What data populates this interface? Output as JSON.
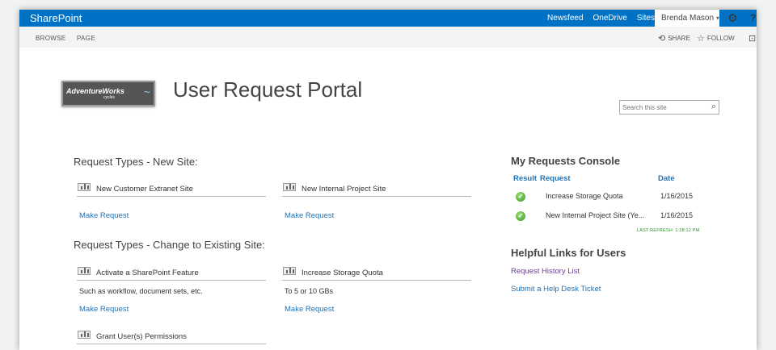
{
  "suite_bar": {
    "brand": "SharePoint",
    "nav": [
      "Newsfeed",
      "OneDrive",
      "Sites"
    ],
    "user": "Brenda Mason",
    "colors": {
      "bar": "#0072c6",
      "link": "#1e72b8",
      "visited": "#6f3b95",
      "ok": "#3a9a1e"
    }
  },
  "ribbon": {
    "tabs": [
      "BROWSE",
      "PAGE"
    ],
    "share": "SHARE",
    "follow": "FOLLOW"
  },
  "logo": {
    "main": "AdventureWorks",
    "sub": "cycles"
  },
  "site_title": "User Request Portal",
  "search": {
    "placeholder": "Search this site"
  },
  "new_site": {
    "title": "Request Types - New Site:",
    "items": [
      {
        "label": "New Customer Extranet Site",
        "action": "Make Request"
      },
      {
        "label": "New Internal Project Site",
        "action": "Make Request"
      }
    ]
  },
  "existing_site": {
    "title": "Request Types - Change to Existing Site:",
    "items": [
      {
        "label": "Activate a SharePoint Feature",
        "desc": "Such as workflow, document sets, etc.",
        "action": "Make Request"
      },
      {
        "label": "Increase Storage Quota",
        "desc": "To 5 or 10 GBs",
        "action": "Make Request"
      },
      {
        "label": "Grant User(s) Permissions"
      }
    ]
  },
  "console": {
    "title": "My Requests Console",
    "headers": [
      "Result",
      "Request",
      "Date"
    ],
    "rows": [
      {
        "request": "Increase Storage Quota",
        "date": "1/16/2015"
      },
      {
        "request": "New Internal Project Site (Ye...",
        "date": "1/16/2015"
      }
    ],
    "last_refresh": "LAST REFRESH: 1:28:12 PM"
  },
  "helpful_links": {
    "title": "Helpful Links for Users",
    "links": [
      "Request History List",
      "Submit a Help Desk Ticket"
    ]
  }
}
